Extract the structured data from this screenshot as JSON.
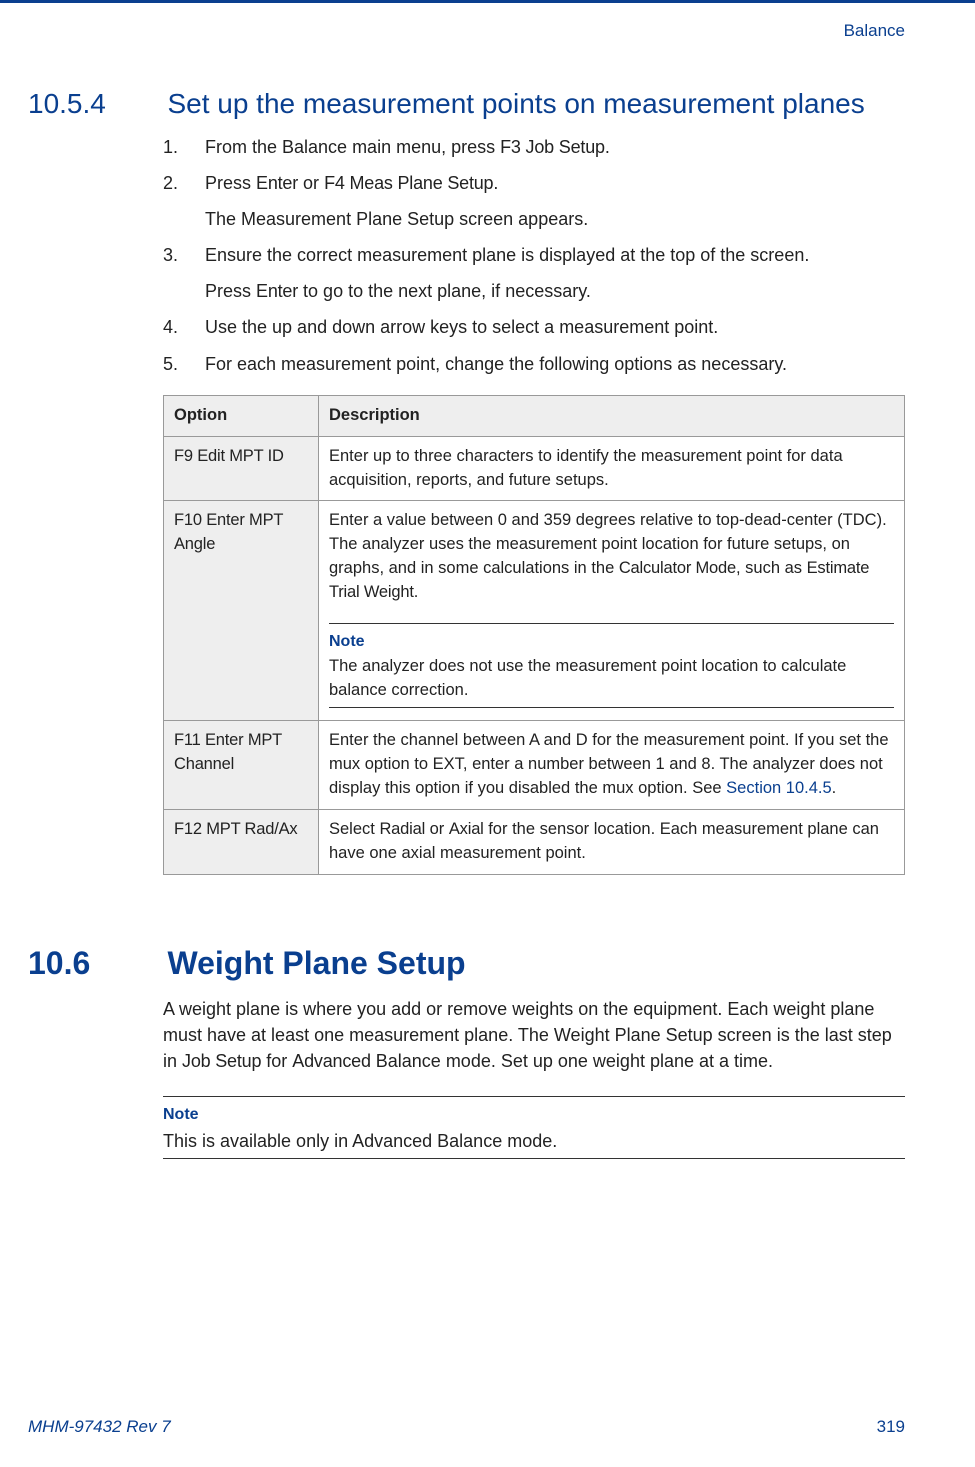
{
  "header": {
    "right": "Balance"
  },
  "section1": {
    "number": "10.5.4",
    "title": "Set up the measurement points on measurement planes",
    "steps": [
      {
        "text_a": "From the Balance main menu, press ",
        "code_a": "F3 Job Setup",
        "text_b": "."
      },
      {
        "text_a": "Press ",
        "code_a": "Enter",
        "text_b": " or ",
        "code_b": "F4 Meas Plane Setup",
        "text_c": ".",
        "sub": "The Measurement Plane Setup screen appears."
      },
      {
        "text_a": "Ensure the correct measurement plane is displayed at the top of the screen.",
        "sub_a": "Press ",
        "sub_code": "Enter",
        "sub_b": " to go to the next plane, if necessary."
      },
      {
        "text_a": "Use the up and down arrow keys to select a measurement point."
      },
      {
        "text_a": "For each measurement point, change the following options as necessary."
      }
    ],
    "table": {
      "head_option": "Option",
      "head_desc": "Description",
      "rows": [
        {
          "option": "F9 Edit MPT ID",
          "desc": "Enter up to three characters to identify the measurement point for data acquisition, reports, and future setups."
        },
        {
          "option": "F10 Enter MPT Angle",
          "desc_a": "Enter a value between 0 and 359 degrees relative to top-dead-center (TDC). The analyzer uses the measurement point location for future setups, on graphs, and in some calculations in the ",
          "desc_code_a": "Calculator Mode",
          "desc_b": ", such as ",
          "desc_code_b": "Estimate Trial Weight",
          "desc_c": ".",
          "note_label": "Note",
          "note_text": "The analyzer does not use the measurement point location to calculate balance correction."
        },
        {
          "option": "F11 Enter MPT Channel",
          "desc_a": "Enter the channel between A and D for the measurement point. If you set the mux option to EXT, enter a number between 1 and 8. The analyzer does not display this option if you disabled the mux option. See ",
          "link": "Section 10.4.5",
          "desc_b": "."
        },
        {
          "option": "F12 MPT Rad/Ax",
          "desc_a": "Select ",
          "desc_code_a": "Radial",
          "desc_b": " or ",
          "desc_code_b": "Axial",
          "desc_c": " for the sensor location. Each measurement plane can have one axial measurement point."
        }
      ]
    }
  },
  "section2": {
    "number": "10.6",
    "title": "Weight Plane Setup",
    "para_a": "A weight plane is where you add or remove weights on the equipment. Each weight plane must have at least one measurement plane. The Weight Plane Setup screen is the last step in ",
    "para_code_a": "Job Setup",
    "para_b": " for ",
    "para_code_b": "Advanced",
    "para_c": " Balance mode. Set up one weight plane at a time.",
    "note_label": "Note",
    "note_text": "This is available only in Advanced Balance mode."
  },
  "footer": {
    "left": "MHM-97432 Rev 7",
    "right": "319"
  }
}
